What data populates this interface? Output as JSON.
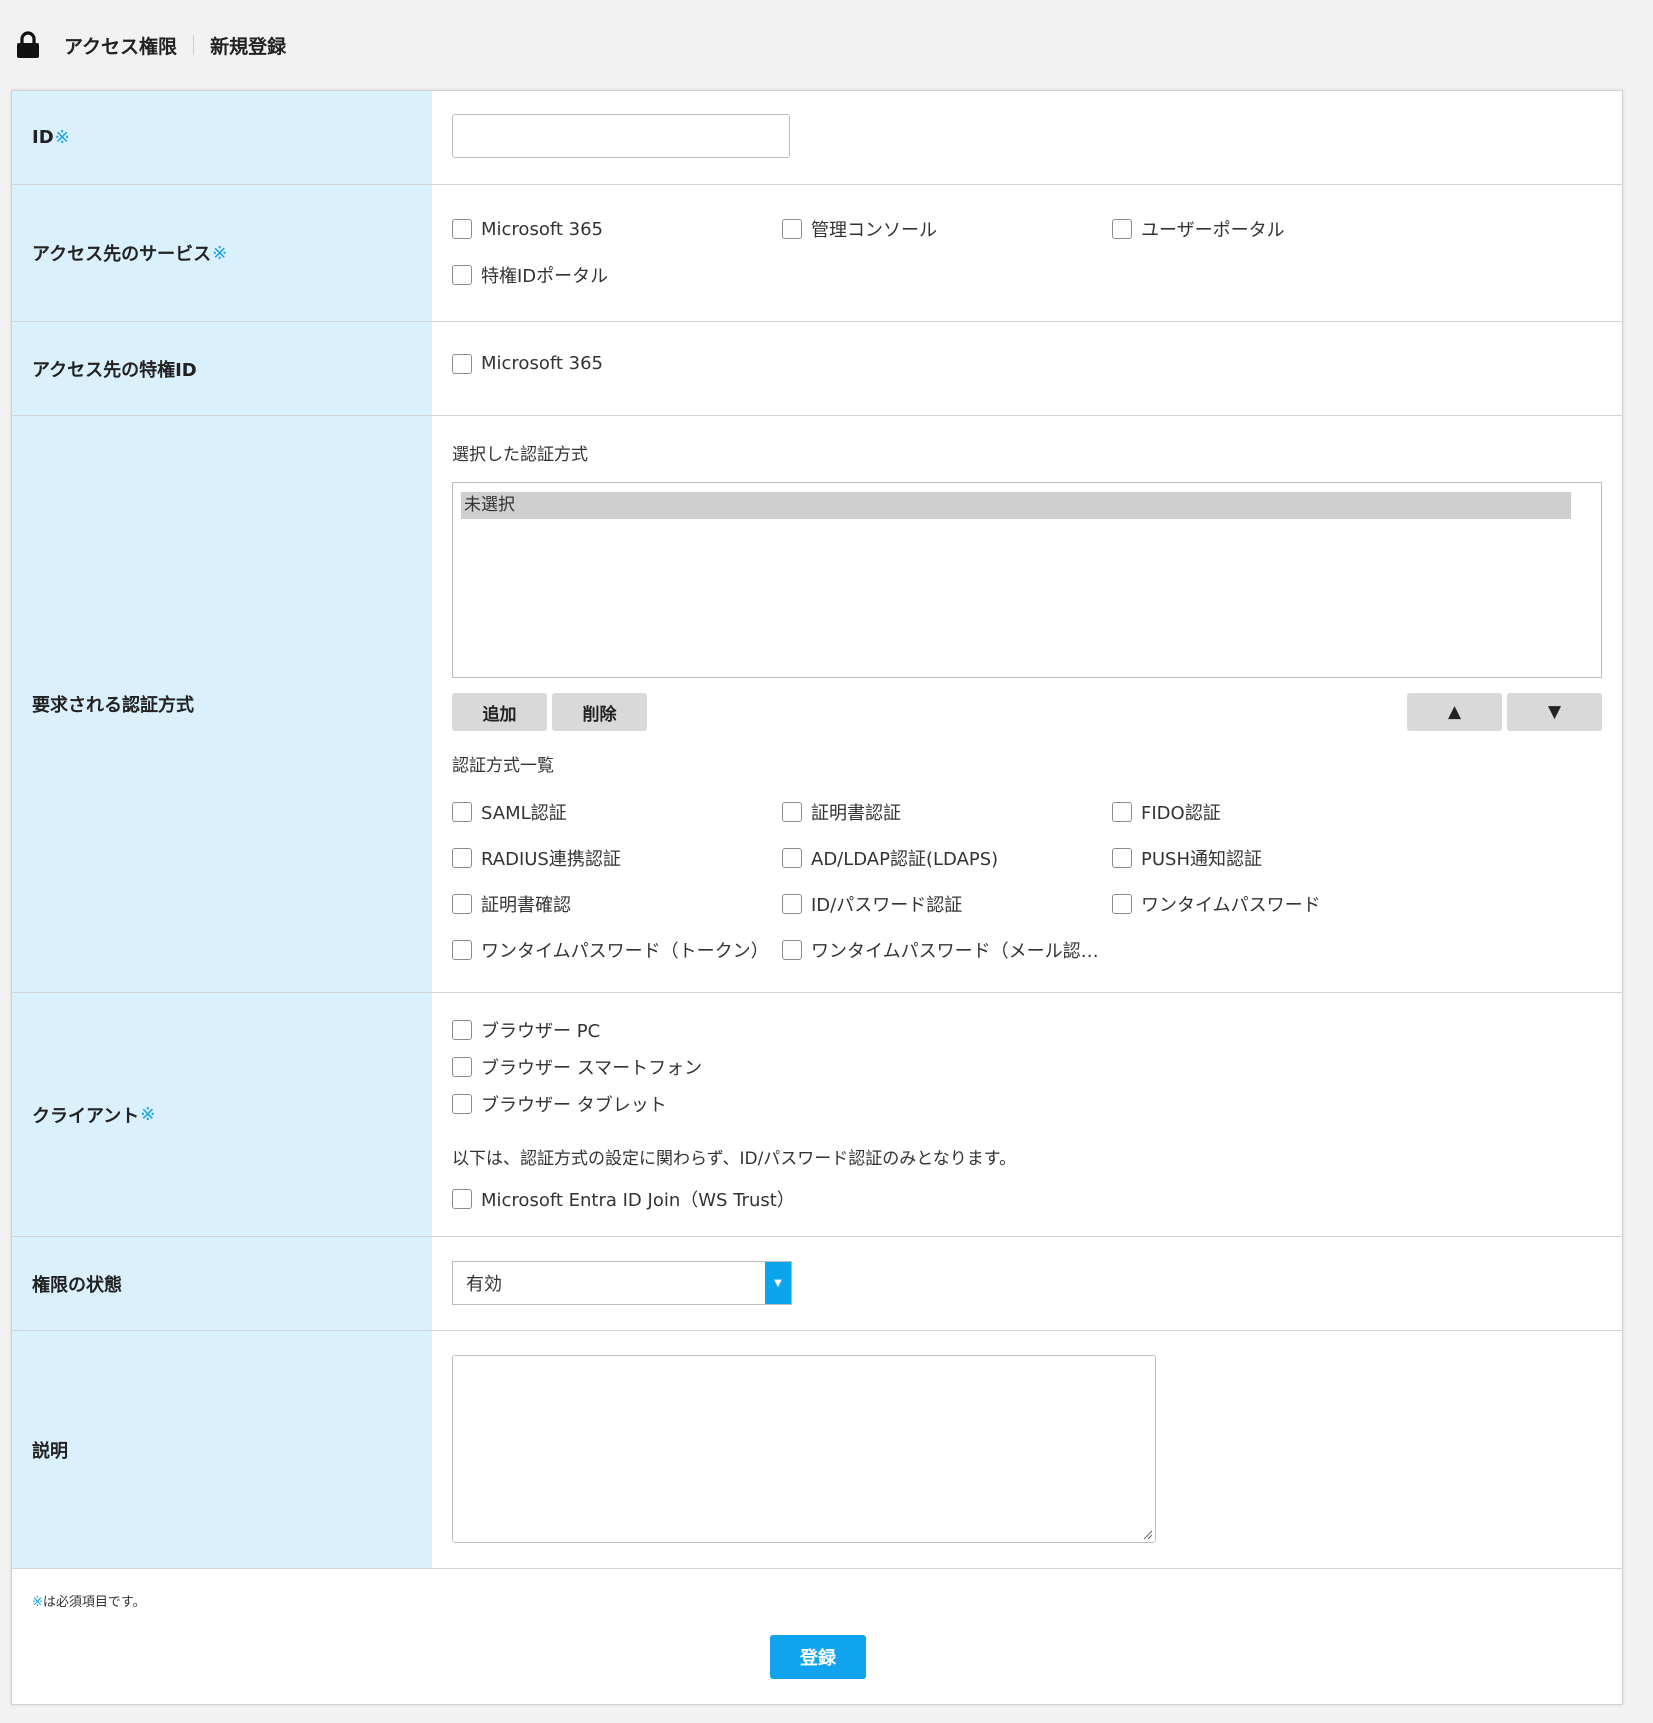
{
  "breadcrumb": {
    "section": "アクセス権限",
    "page": "新規登録"
  },
  "required_mark": "※",
  "rows": {
    "id": {
      "label": "ID",
      "value": ""
    },
    "services": {
      "label": "アクセス先のサービス",
      "options": [
        "Microsoft 365",
        "管理コンソール",
        "ユーザーポータル",
        "特権IDポータル"
      ]
    },
    "privileged_id": {
      "label": "アクセス先の特権ID",
      "options": [
        "Microsoft 365"
      ]
    },
    "auth": {
      "label": "要求される認証方式",
      "selected_heading": "選択した認証方式",
      "selected_items": [
        "未選択"
      ],
      "add_button": "追加",
      "delete_button": "削除",
      "up_button": "▲",
      "down_button": "▼",
      "list_heading": "認証方式一覧",
      "methods": [
        "SAML認証",
        "証明書認証",
        "FIDO認証",
        "RADIUS連携認証",
        "AD/LDAP認証(LDAPS)",
        "PUSH通知認証",
        "証明書確認",
        "ID/パスワード認証",
        "ワンタイムパスワード",
        "ワンタイムパスワード（トークン）",
        "ワンタイムパスワード（メール認…"
      ]
    },
    "client": {
      "label": "クライアント",
      "options": [
        "ブラウザー PC",
        "ブラウザー スマートフォン",
        "ブラウザー タブレット"
      ],
      "note": "以下は、認証方式の設定に関わらず、ID/パスワード認証のみとなります。",
      "extra_options": [
        "Microsoft Entra ID Join（WS Trust）"
      ]
    },
    "status": {
      "label": "権限の状態",
      "value": "有効"
    },
    "description": {
      "label": "説明",
      "value": ""
    }
  },
  "footer": {
    "note": "は必須項目です。",
    "submit_label": "登録"
  },
  "colors": {
    "accent": "#10a3ee",
    "label_bg": "#daf1fd",
    "required": "#1aa3e8"
  }
}
